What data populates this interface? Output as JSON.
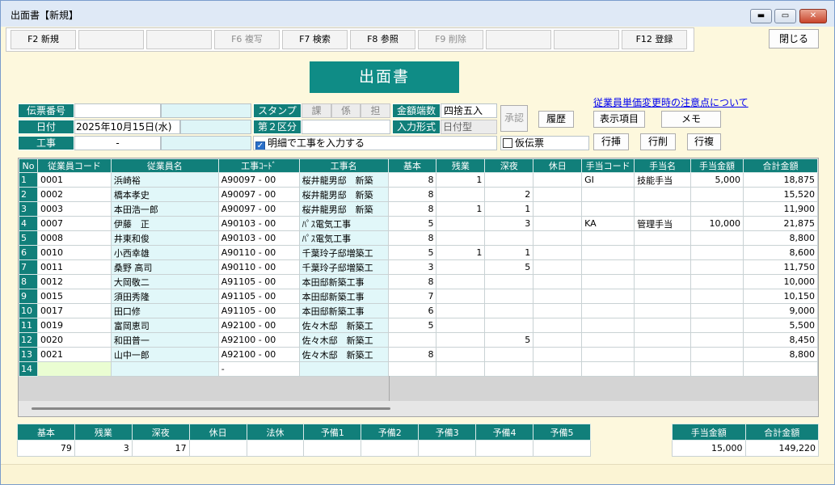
{
  "window": {
    "title": "出面書【新規】",
    "min": "▬",
    "max": "▭",
    "close": "✕"
  },
  "toolbar": [
    {
      "label": "F2 新規",
      "enabled": true
    },
    {
      "label": "",
      "enabled": false
    },
    {
      "label": "",
      "enabled": false
    },
    {
      "label": "F6 複写",
      "enabled": false
    },
    {
      "label": "F7 検索",
      "enabled": true
    },
    {
      "label": "F8 参照",
      "enabled": true
    },
    {
      "label": "F9 削除",
      "enabled": false
    },
    {
      "label": "",
      "enabled": false
    },
    {
      "label": "",
      "enabled": false
    },
    {
      "label": "F12 登録",
      "enabled": true
    }
  ],
  "close_label": "閉じる",
  "banner": "出面書",
  "link": "従業員単価変更時の注意点について",
  "form": {
    "voucher_label": "伝票番号",
    "voucher_value": "",
    "date_label": "日付",
    "date_value": "2025年10月15日(水)",
    "job_label": "工事",
    "job_value": "-",
    "stamp_label": "スタンプ",
    "stamp_1": "課",
    "stamp_2": "係",
    "stamp_3": "担",
    "section2_label": "第２区分",
    "section2_value": "",
    "detail_check_label": "明細で工事を入力する",
    "detail_checked": true,
    "rounding_label": "金額端数",
    "rounding_value": "四捨五入",
    "input_label": "入力形式",
    "input_value": "日付型",
    "approve": "承認",
    "history": "履歴",
    "provisional_label": "仮伝票",
    "provisional_checked": false
  },
  "buttons": {
    "display_items": "表示項目",
    "memo": "メモ",
    "row_insert": "行挿",
    "row_delete": "行削",
    "row_copy": "行複"
  },
  "grid": {
    "headers": [
      "No",
      "従業員コード",
      "従業員名",
      "工事ｺｰﾄﾞ",
      "工事名",
      "基本",
      "残業",
      "深夜",
      "休日",
      "手当コード",
      "手当名",
      "手当金額",
      "合計金額"
    ],
    "rows": [
      [
        "1",
        "0001",
        "浜崎裕",
        "A90097 - 00",
        "桜井龍男邸　新築",
        "8",
        "1",
        "",
        "",
        "GI",
        "技能手当",
        "5,000",
        "18,875"
      ],
      [
        "2",
        "0002",
        "橋本孝史",
        "A90097 - 00",
        "桜井龍男邸　新築",
        "8",
        "",
        "2",
        "",
        "",
        "",
        "",
        "15,520"
      ],
      [
        "3",
        "0003",
        "本田浩一郎",
        "A90097 - 00",
        "桜井龍男邸　新築",
        "8",
        "1",
        "1",
        "",
        "",
        "",
        "",
        "11,900"
      ],
      [
        "4",
        "0007",
        "伊藤　正",
        "A90103 - 00",
        "ﾊﾟｽ電気工事",
        "5",
        "",
        "3",
        "",
        "KA",
        "管理手当",
        "10,000",
        "21,875"
      ],
      [
        "5",
        "0008",
        "井東和俊",
        "A90103 - 00",
        "ﾊﾟｽ電気工事",
        "8",
        "",
        "",
        "",
        "",
        "",
        "",
        "8,800"
      ],
      [
        "6",
        "0010",
        "小西幸雄",
        "A90110 - 00",
        "千葉玲子邸増築工",
        "5",
        "1",
        "1",
        "",
        "",
        "",
        "",
        "8,600"
      ],
      [
        "7",
        "0011",
        "桑野 高司",
        "A90110 - 00",
        "千葉玲子邸増築工",
        "3",
        "",
        "5",
        "",
        "",
        "",
        "",
        "11,750"
      ],
      [
        "8",
        "0012",
        "大岡敬二",
        "A91105 - 00",
        "本田邸新築工事",
        "8",
        "",
        "",
        "",
        "",
        "",
        "",
        "10,000"
      ],
      [
        "9",
        "0015",
        "須田秀隆",
        "A91105 - 00",
        "本田邸新築工事",
        "7",
        "",
        "",
        "",
        "",
        "",
        "",
        "10,150"
      ],
      [
        "10",
        "0017",
        "田口修",
        "A91105 - 00",
        "本田邸新築工事",
        "6",
        "",
        "",
        "",
        "",
        "",
        "",
        "9,000"
      ],
      [
        "11",
        "0019",
        "富岡恵司",
        "A92100 - 00",
        "佐々木邸　新築工",
        "5",
        "",
        "",
        "",
        "",
        "",
        "",
        "5,500"
      ],
      [
        "12",
        "0020",
        "和田普一",
        "A92100 - 00",
        "佐々木邸　新築工",
        "",
        "",
        "5",
        "",
        "",
        "",
        "",
        "8,450"
      ],
      [
        "13",
        "0021",
        "山中一郎",
        "A92100 - 00",
        "佐々木邸　新築工",
        "8",
        "",
        "",
        "",
        "",
        "",
        "",
        "8,800"
      ],
      [
        "14",
        "",
        "",
        "-",
        "",
        "",
        "",
        "",
        "",
        "",
        "",
        "",
        ""
      ]
    ]
  },
  "summary": {
    "headers": [
      "基本",
      "残業",
      "深夜",
      "休日",
      "法休",
      "予備1",
      "予備2",
      "予備3",
      "予備4",
      "予備5"
    ],
    "values": [
      "79",
      "3",
      "17",
      "",
      "",
      "",
      "",
      "",
      "",
      ""
    ]
  },
  "totals": {
    "headers": [
      "手当金額",
      "合計金額"
    ],
    "values": [
      "15,000",
      "149,220"
    ]
  },
  "colors": {
    "teal": "#117f7a",
    "cyan_cell": "#def5f7",
    "window_bg": "#fdf8dd"
  }
}
